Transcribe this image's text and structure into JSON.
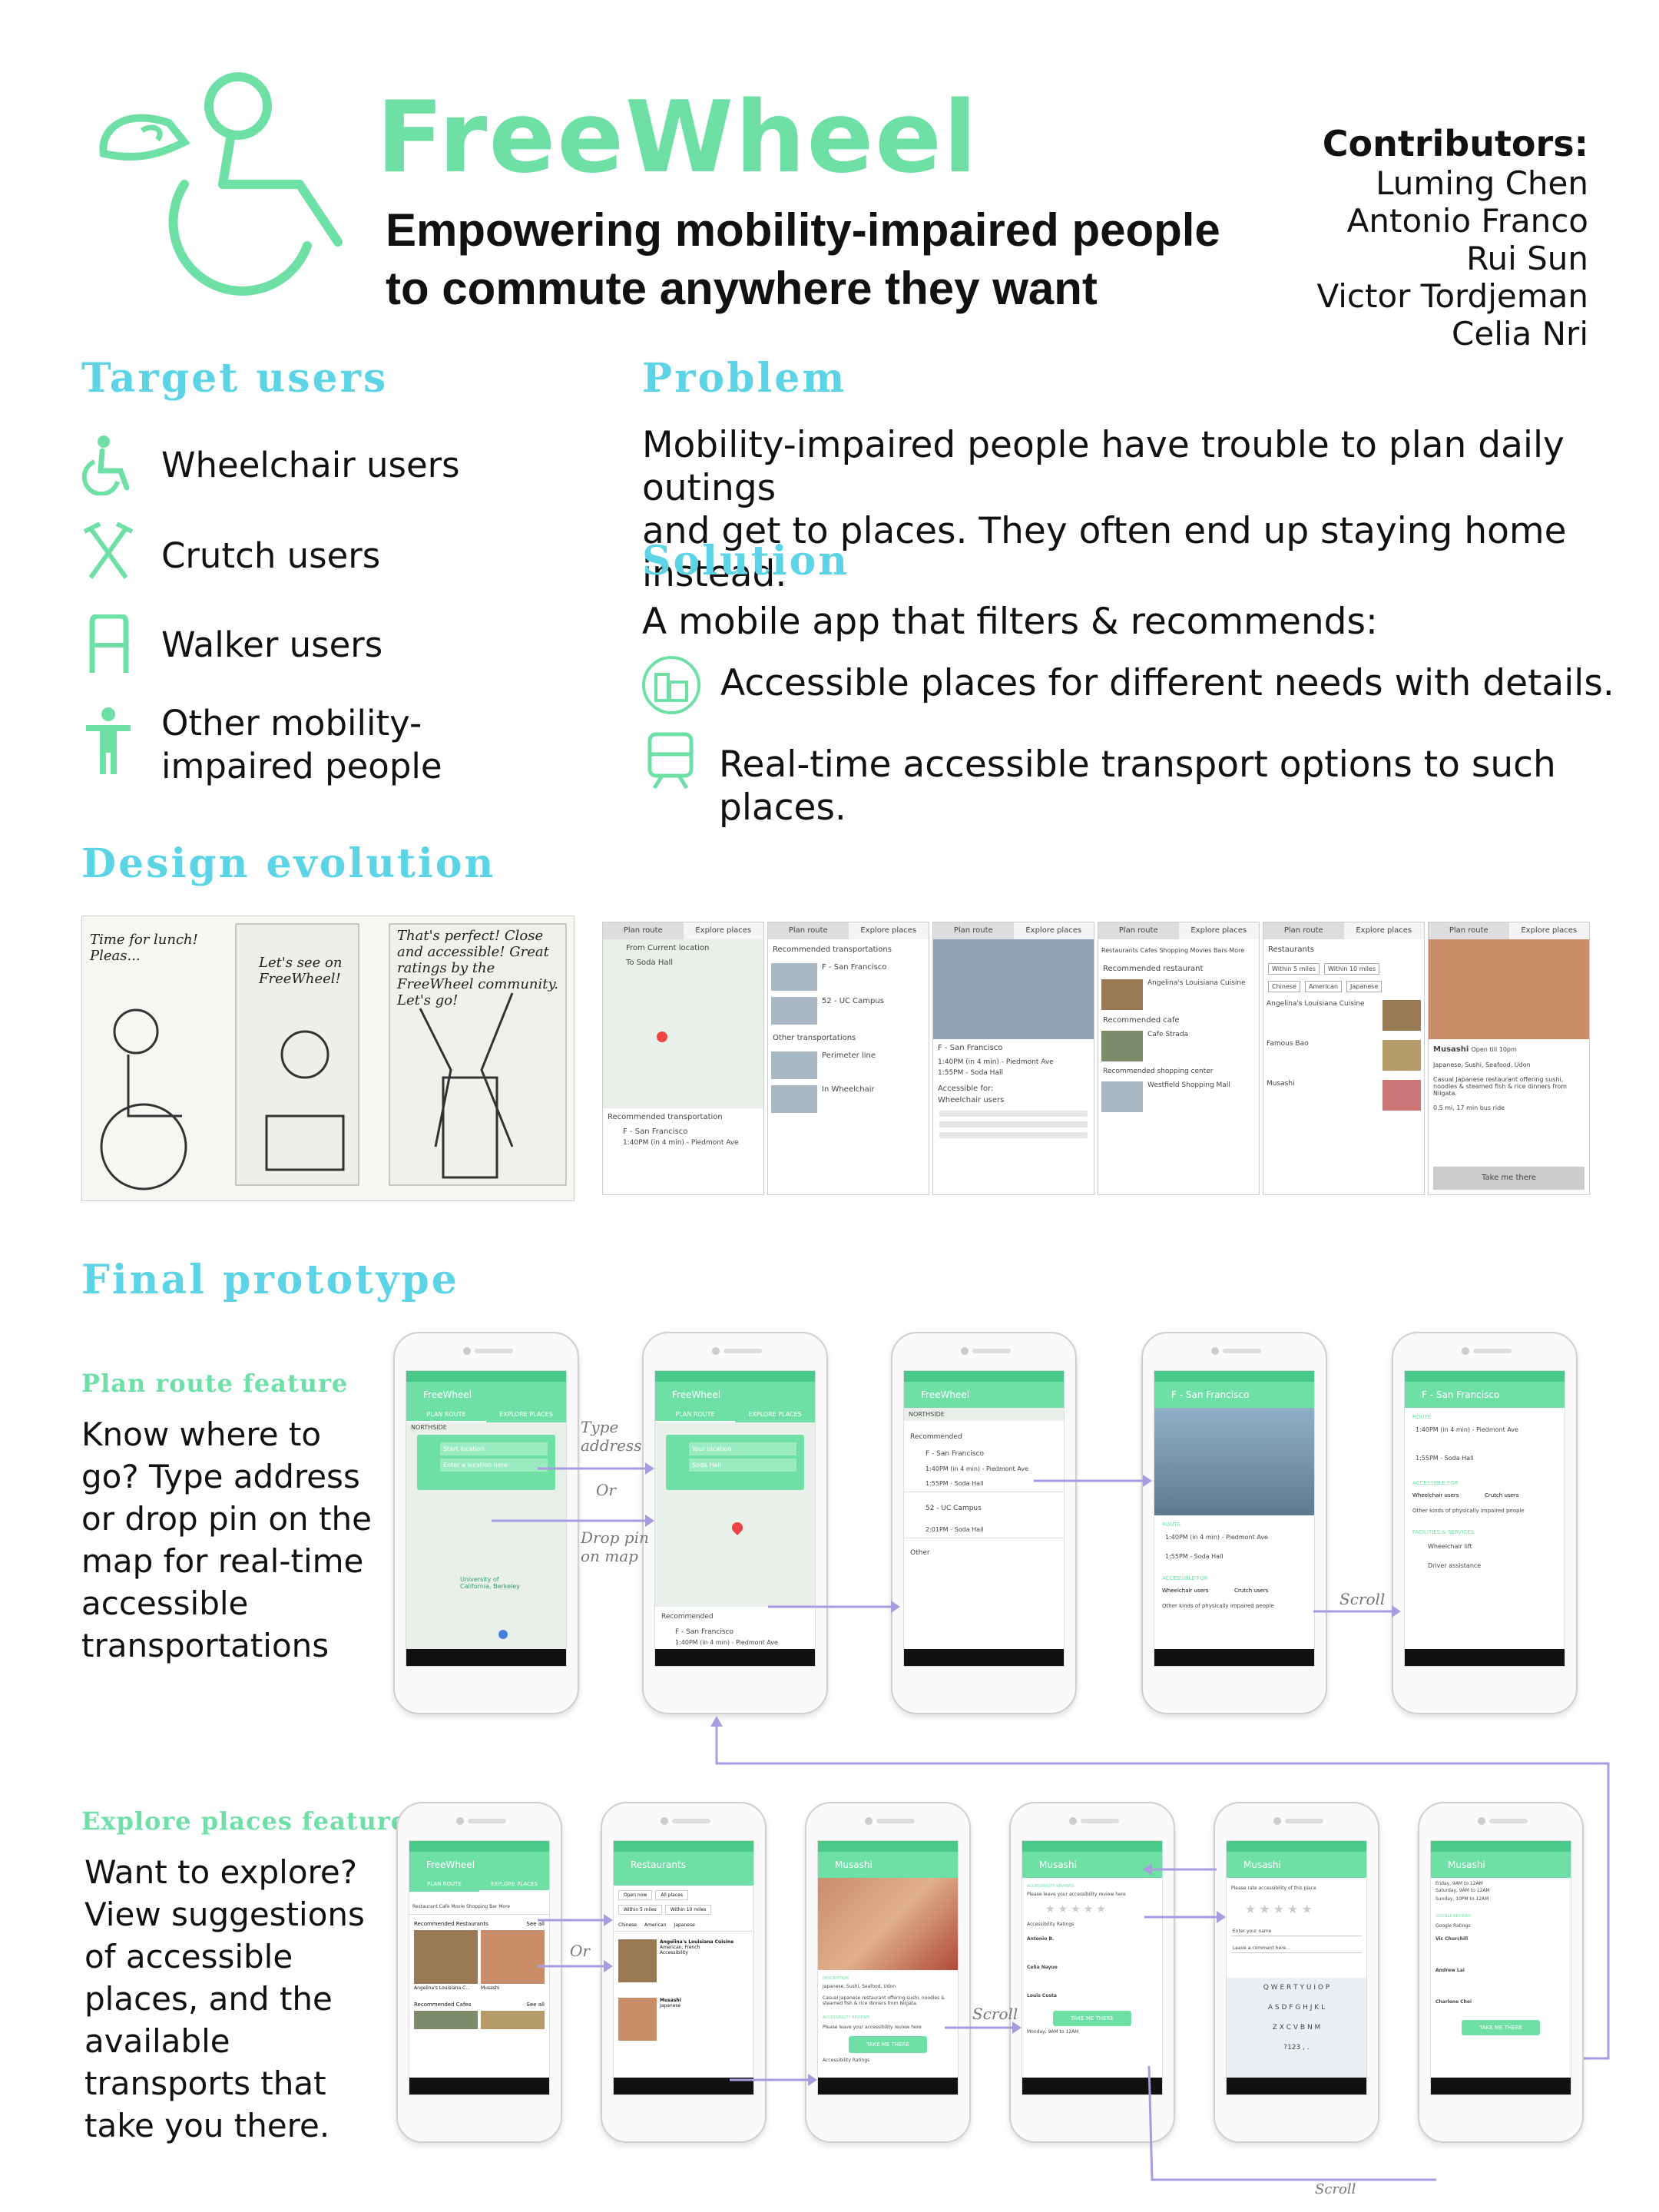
{
  "header": {
    "brand": "FreeWheel",
    "tagline_line1": "Empowering mobility-impaired people",
    "tagline_line2": "to commute anywhere they want",
    "contributors_title": "Contributors:",
    "contributors": [
      "Luming Chen",
      "Antonio Franco",
      "Rui Sun",
      "Victor Tordjeman",
      "Celia Nri"
    ]
  },
  "target_users": {
    "title": "Target users",
    "items": [
      {
        "label": "Wheelchair users",
        "icon": "wheelchair-icon"
      },
      {
        "label": "Crutch users",
        "icon": "crutch-icon"
      },
      {
        "label": "Walker users",
        "icon": "walker-icon"
      },
      {
        "label": "Other mobility-",
        "label2": "impaired people",
        "icon": "person-icon"
      }
    ]
  },
  "problem": {
    "title": "Problem",
    "line1": "Mobility-impaired people have trouble to plan daily outings",
    "line2": "and get to places. They often end up staying home instead."
  },
  "solution": {
    "title": "Solution",
    "intro": "A mobile app that filters & recommends:",
    "items": [
      {
        "label": "Accessible places for different needs with details.",
        "icon": "buildings-icon"
      },
      {
        "label": "Real-time accessible transport options to such places.",
        "icon": "train-icon"
      }
    ]
  },
  "design_evolution": {
    "title": "Design evolution",
    "sketch_texts": [
      "Time for lunch! Pleas...",
      "Let's see on FreeWheel!",
      "That's perfect! Close and accessible! Great ratings by the FreeWheel community. Let's go!"
    ],
    "screens": [
      {
        "tab1": "Plan route",
        "tab2": "Explore places",
        "rows": [
          "From Current location",
          "To Soda Hall",
          "Recommended transportation",
          "F - San Francisco",
          "1:40PM (in 4 min) - Piedmont Ave"
        ]
      },
      {
        "tab1": "Plan route",
        "tab2": "Explore places",
        "rows": [
          "Recommended transportations",
          "F - San Francisco",
          "52 - UC Campus",
          "Other transportations",
          "Perimeter line",
          "In Wheelchair"
        ]
      },
      {
        "tab1": "Plan route",
        "tab2": "Explore places",
        "rows": [
          "F - San Francisco",
          "1:40PM (in 4 min) - Piedmont Ave",
          "1:55PM - Soda Hall",
          "Accessible for:",
          "Wheelchair users"
        ]
      },
      {
        "tab1": "Plan route",
        "tab2": "Explore places",
        "rows": [
          "Restaurants Cafes Shopping Movies Bars More",
          "Recommended restaurant",
          "Angelina's Louisiana Cuisine",
          "Recommended cafe",
          "Cafe Strada",
          "Recommended shopping center",
          "Westfield Shopping Mall"
        ]
      },
      {
        "tab1": "Plan route",
        "tab2": "Explore places",
        "rows": [
          "Restaurants",
          "Within 5 miles",
          "Within 10 miles",
          "Chinese",
          "American",
          "Japanese",
          "Angelina's Louisiana Cuisine",
          "Famous Bao",
          "Musashi"
        ]
      },
      {
        "tab1": "Plan route",
        "tab2": "Explore places",
        "rows": [
          "Musashi",
          "Open till 10pm",
          "Japanese, Sushi, Seafood, Udon",
          "Casual Japanese restaurant offering sushi, noodles & steamed fish & rice dinners from Niigata.",
          "0.5 mi, 17 min bus ride",
          "Take me there"
        ]
      }
    ]
  },
  "final_prototype": {
    "title": "Final prototype",
    "plan_route": {
      "title": "Plan route feature",
      "desc": [
        "Know where to",
        "go? Type address",
        "or drop pin on the",
        "map for real-time",
        "accessible",
        "transportations"
      ],
      "annotations": {
        "type_address": "Type address",
        "or": "Or",
        "drop_pin": "Drop pin on map",
        "scroll": "Scroll"
      },
      "phones": [
        {
          "bar": "FreeWheel",
          "tabs": [
            "PLAN ROUTE",
            "EXPLORE PLACES"
          ],
          "rows": [
            "Start location",
            "Enter a location here",
            "NORTHSIDE",
            "University of California, Berkeley"
          ]
        },
        {
          "bar": "FreeWheel",
          "tabs": [
            "PLAN ROUTE",
            "EXPLORE PLACES"
          ],
          "rows": [
            "Your location",
            "Soda Hall",
            "Recommended",
            "F - San Francisco",
            "1:40PM (in 4 min) - Piedmont Ave"
          ]
        },
        {
          "bar": "FreeWheel",
          "tabs": [],
          "rows": [
            "NORTHSIDE",
            "Recommended",
            "F - San Francisco",
            "1:40PM (in 4 min) - Piedmont Ave",
            "1:55PM - Soda Hall",
            "52 - UC Campus",
            "2:01PM - Soda Hall",
            "Other"
          ]
        },
        {
          "bar": "F - San Francisco",
          "tabs": [],
          "rows": [
            "ROUTE",
            "1:40PM (in 4 min) - Piedmont Ave",
            "1:55PM - Soda Hall",
            "ACCESSIBLE FOR",
            "Wheelchair users",
            "Crutch users",
            "Other kinds of physically impaired people"
          ]
        },
        {
          "bar": "F - San Francisco",
          "tabs": [],
          "rows": [
            "ROUTE",
            "1:40PM (in 4 min) - Piedmont Ave",
            "1:55PM - Soda Hall",
            "ACCESSIBLE FOR",
            "Wheelchair users",
            "Crutch users",
            "Other kinds of physically impaired people",
            "FACILITIES & SERVICES",
            "Wheelchair lift",
            "Driver assistance"
          ]
        }
      ]
    },
    "explore_places": {
      "title": "Explore places feature",
      "desc": [
        "Want to explore?",
        "View suggestions",
        "of accessible",
        "places, and the",
        "available",
        "transports that",
        "take you there."
      ],
      "annotations": {
        "or": "Or",
        "scroll1": "Scroll",
        "scroll2": "Scroll"
      },
      "phones": [
        {
          "bar": "FreeWheel",
          "rows": [
            "PLAN ROUTE",
            "EXPLORE PLACES",
            "Restaurant Cafe Movie Shopping Bar More",
            "Recommended Restaurants",
            "See all",
            "Angelina's Louisiana C...",
            "Musashi",
            "Recommended Cafes",
            "See all"
          ]
        },
        {
          "bar": "Restaurants",
          "rows": [
            "Open now",
            "All places",
            "Within 5 miles",
            "Within 10 miles",
            "Chinese",
            "American",
            "Japanese",
            "Angelina's Louisiana Cuisine",
            "American, French",
            "Accessibility",
            "Musashi",
            "Japanese"
          ]
        },
        {
          "bar": "Musashi",
          "rows": [
            "DESCRIPTION",
            "Japanese, Sushi, Seafood, Udon",
            "Casual Japanese restaurant offering sushi, noodles & steamed fish & rice dinners from Niigata.",
            "ACCESSIBILITY REVIEWS",
            "Please leave your accessibility review here",
            "TAKE ME THERE",
            "Accessibility Ratings"
          ]
        },
        {
          "bar": "Musashi",
          "rows": [
            "ACCESSIBILITY REVIEWS",
            "Please leave your accessibility review here",
            "Accessibility Ratings",
            "Antonio B.",
            "Celia Nayue",
            "Louis Costa",
            "TAKE ME THERE",
            "Monday, 9AM to 12AM"
          ]
        },
        {
          "bar": "Musashi",
          "rows": [
            "Please rate accessibility of this place",
            "Enter your name",
            "Leave a comment here..."
          ]
        },
        {
          "bar": "Musashi",
          "rows": [
            "Friday, 9AM to 12AM",
            "Saturday, 9AM to 12AM",
            "Sunday, 10PM to 12AM",
            "GOOGLE REVIEWS",
            "Google Ratings",
            "Vic Churchill",
            "Andrew Lai",
            "Charlene Choi",
            "TAKE ME THERE"
          ]
        }
      ]
    }
  },
  "colors": {
    "brand_green": "#6ee0a6",
    "section_cyan": "#5cd4e6",
    "arrow_purple": "#a99be0"
  }
}
